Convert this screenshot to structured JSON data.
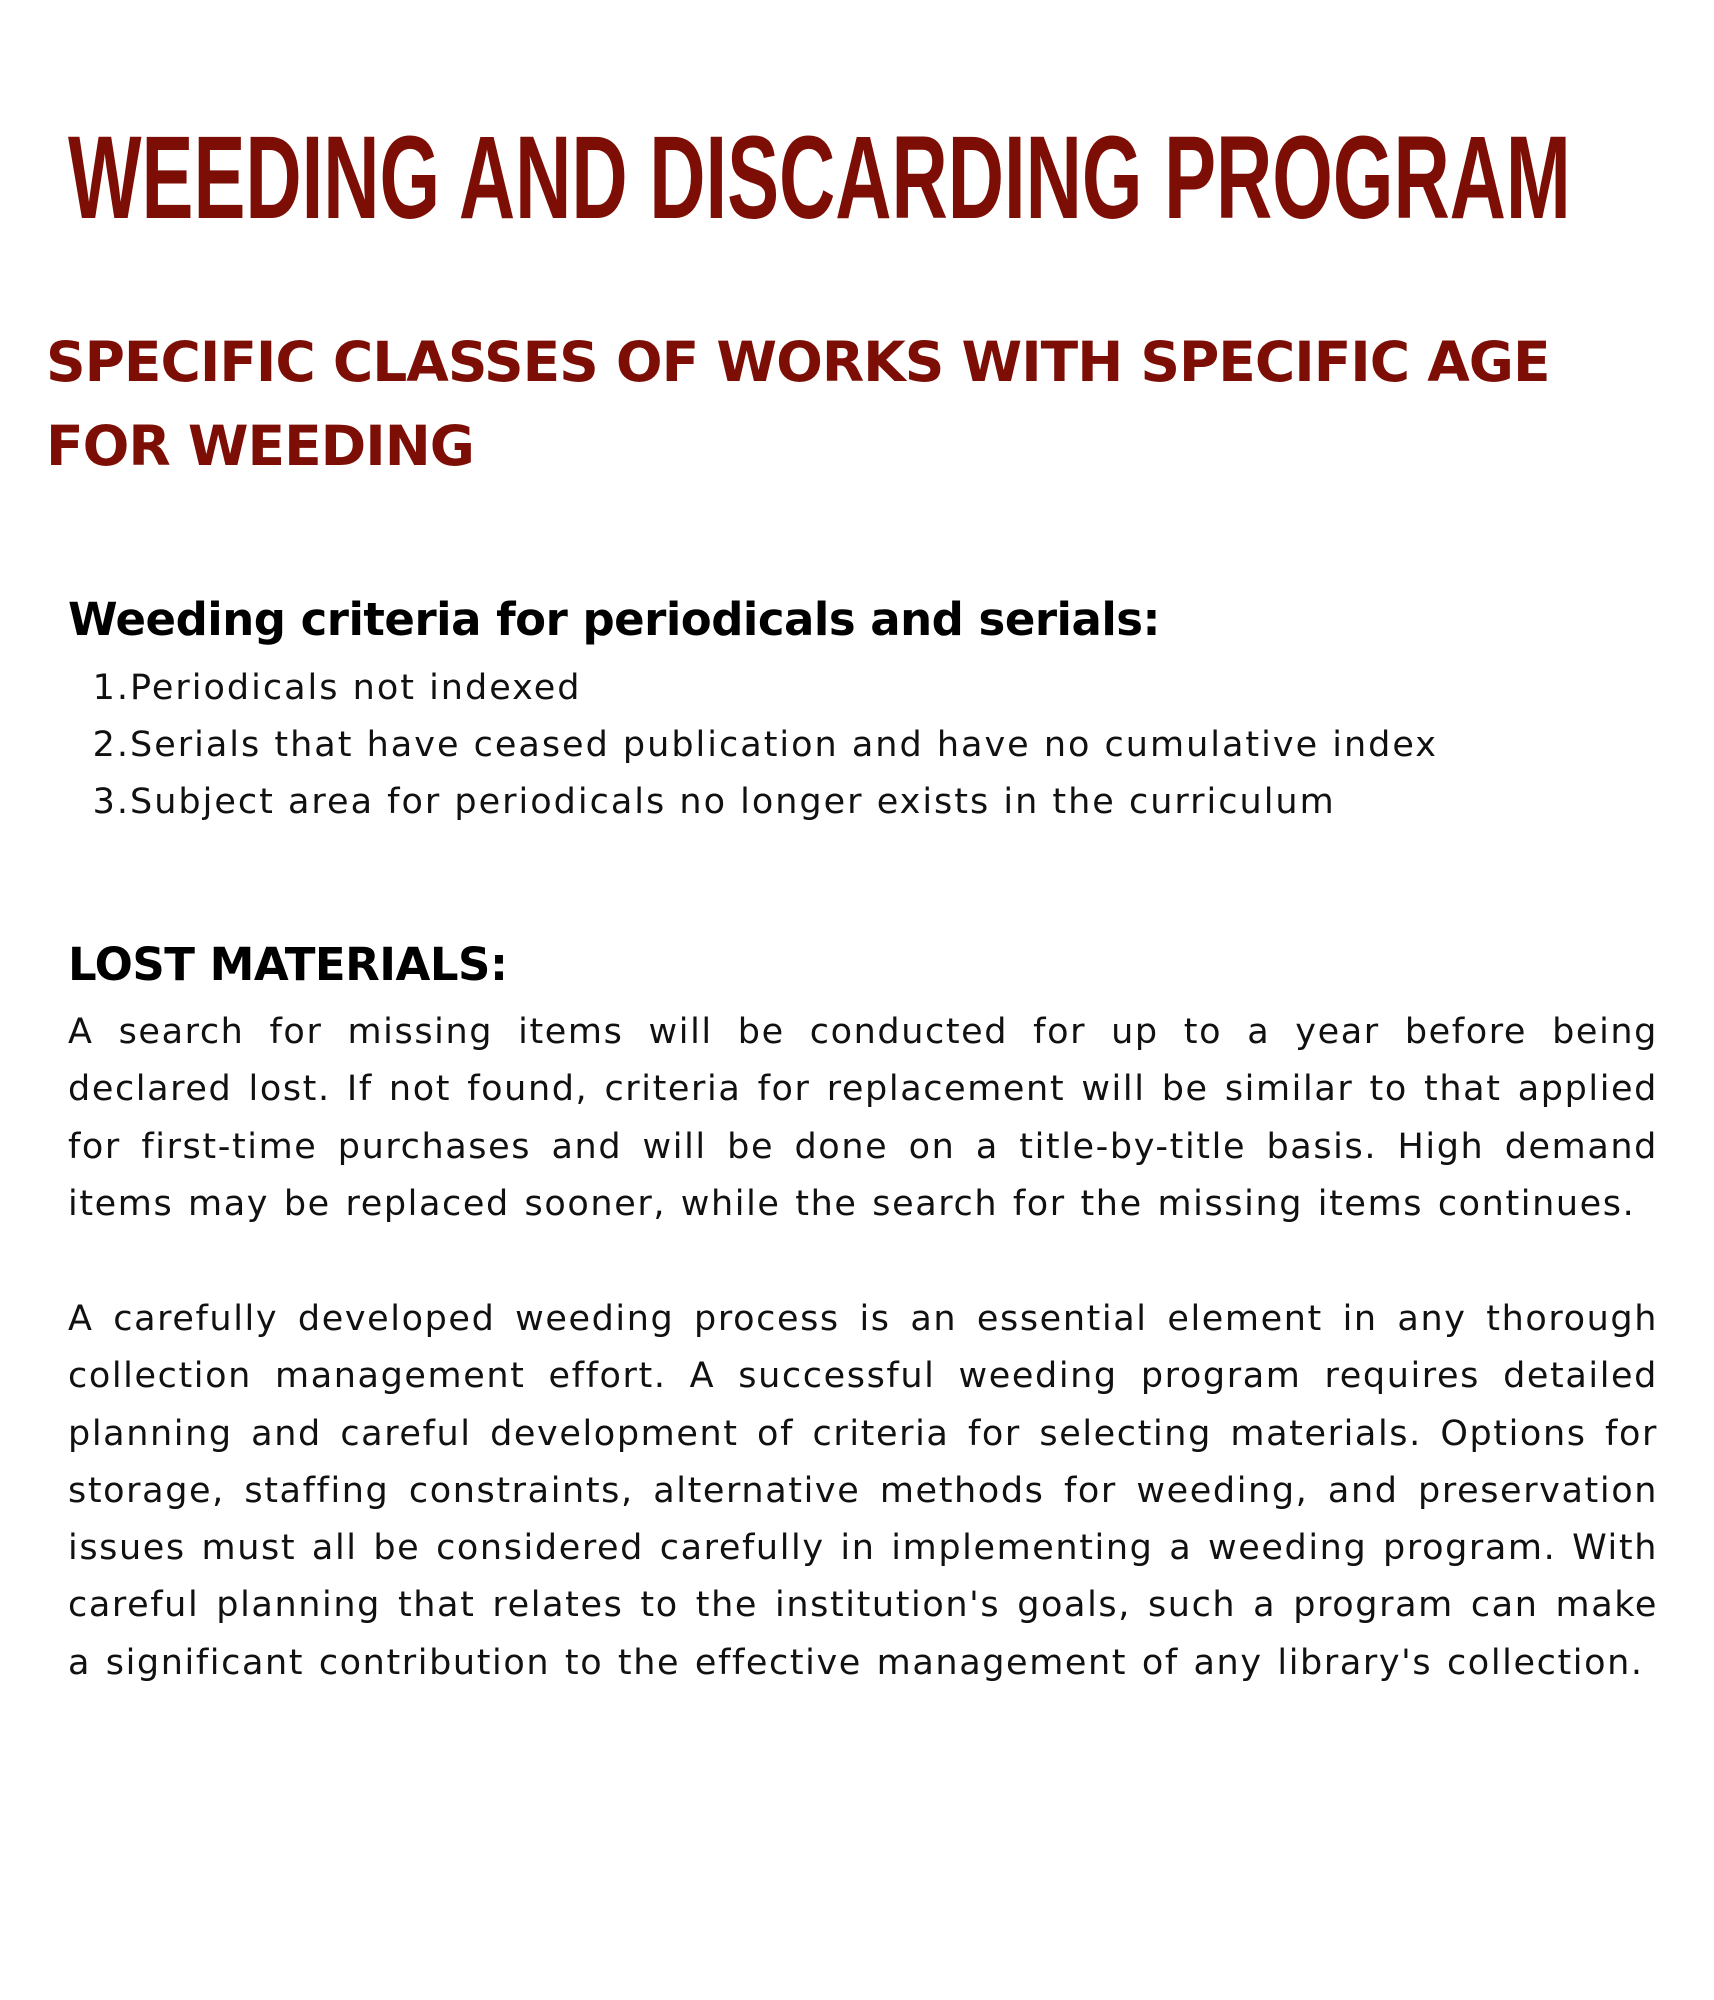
{
  "title": "WEEDING AND DISCARDING PROGRAM",
  "subtitle": "SPECIFIC CLASSES OF WORKS WITH SPECIFIC AGE FOR WEEDING",
  "criteria": {
    "heading": "Weeding criteria for periodicals and serials:",
    "items": [
      {
        "num": "1.",
        "text": "Periodicals not indexed"
      },
      {
        "num": "2.",
        "text": "Serials that have ceased publication and have no cumulative index"
      },
      {
        "num": "3.",
        "text": "Subject area for periodicals no longer exists in the curriculum"
      }
    ]
  },
  "lost": {
    "heading": "LOST MATERIALS:",
    "paragraphs": [
      "A search for missing items will be conducted for up to a year before being declared lost. If not found, criteria for replacement will be similar to that applied for first-time purchases and will be done on a title-by-title basis. High demand items may be replaced sooner, while the search for the missing items continues.",
      "A carefully developed weeding process is an essential element in any thorough collection management effort. A successful weeding program requires detailed planning and careful development of criteria for selecting materials. Options for storage, staffing constraints, alternative methods for weeding, and preservation issues must all be considered carefully in implementing a weeding program. With careful planning that relates to the institution's goals, such a program can make a significant contribution to the effective management of any library's collection."
    ]
  },
  "colors": {
    "accent": "#7d0e05",
    "text": "#111111",
    "background": "#ffffff"
  }
}
